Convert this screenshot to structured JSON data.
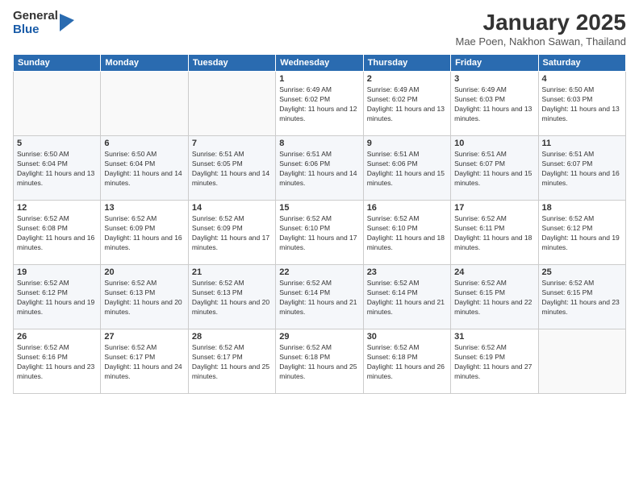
{
  "logo": {
    "general": "General",
    "blue": "Blue"
  },
  "header": {
    "month": "January 2025",
    "location": "Mae Poen, Nakhon Sawan, Thailand"
  },
  "weekdays": [
    "Sunday",
    "Monday",
    "Tuesday",
    "Wednesday",
    "Thursday",
    "Friday",
    "Saturday"
  ],
  "weeks": [
    [
      {
        "day": "",
        "sunrise": "",
        "sunset": "",
        "daylight": ""
      },
      {
        "day": "",
        "sunrise": "",
        "sunset": "",
        "daylight": ""
      },
      {
        "day": "",
        "sunrise": "",
        "sunset": "",
        "daylight": ""
      },
      {
        "day": "1",
        "sunrise": "Sunrise: 6:49 AM",
        "sunset": "Sunset: 6:02 PM",
        "daylight": "Daylight: 11 hours and 12 minutes."
      },
      {
        "day": "2",
        "sunrise": "Sunrise: 6:49 AM",
        "sunset": "Sunset: 6:02 PM",
        "daylight": "Daylight: 11 hours and 13 minutes."
      },
      {
        "day": "3",
        "sunrise": "Sunrise: 6:49 AM",
        "sunset": "Sunset: 6:03 PM",
        "daylight": "Daylight: 11 hours and 13 minutes."
      },
      {
        "day": "4",
        "sunrise": "Sunrise: 6:50 AM",
        "sunset": "Sunset: 6:03 PM",
        "daylight": "Daylight: 11 hours and 13 minutes."
      }
    ],
    [
      {
        "day": "5",
        "sunrise": "Sunrise: 6:50 AM",
        "sunset": "Sunset: 6:04 PM",
        "daylight": "Daylight: 11 hours and 13 minutes."
      },
      {
        "day": "6",
        "sunrise": "Sunrise: 6:50 AM",
        "sunset": "Sunset: 6:04 PM",
        "daylight": "Daylight: 11 hours and 14 minutes."
      },
      {
        "day": "7",
        "sunrise": "Sunrise: 6:51 AM",
        "sunset": "Sunset: 6:05 PM",
        "daylight": "Daylight: 11 hours and 14 minutes."
      },
      {
        "day": "8",
        "sunrise": "Sunrise: 6:51 AM",
        "sunset": "Sunset: 6:06 PM",
        "daylight": "Daylight: 11 hours and 14 minutes."
      },
      {
        "day": "9",
        "sunrise": "Sunrise: 6:51 AM",
        "sunset": "Sunset: 6:06 PM",
        "daylight": "Daylight: 11 hours and 15 minutes."
      },
      {
        "day": "10",
        "sunrise": "Sunrise: 6:51 AM",
        "sunset": "Sunset: 6:07 PM",
        "daylight": "Daylight: 11 hours and 15 minutes."
      },
      {
        "day": "11",
        "sunrise": "Sunrise: 6:51 AM",
        "sunset": "Sunset: 6:07 PM",
        "daylight": "Daylight: 11 hours and 16 minutes."
      }
    ],
    [
      {
        "day": "12",
        "sunrise": "Sunrise: 6:52 AM",
        "sunset": "Sunset: 6:08 PM",
        "daylight": "Daylight: 11 hours and 16 minutes."
      },
      {
        "day": "13",
        "sunrise": "Sunrise: 6:52 AM",
        "sunset": "Sunset: 6:09 PM",
        "daylight": "Daylight: 11 hours and 16 minutes."
      },
      {
        "day": "14",
        "sunrise": "Sunrise: 6:52 AM",
        "sunset": "Sunset: 6:09 PM",
        "daylight": "Daylight: 11 hours and 17 minutes."
      },
      {
        "day": "15",
        "sunrise": "Sunrise: 6:52 AM",
        "sunset": "Sunset: 6:10 PM",
        "daylight": "Daylight: 11 hours and 17 minutes."
      },
      {
        "day": "16",
        "sunrise": "Sunrise: 6:52 AM",
        "sunset": "Sunset: 6:10 PM",
        "daylight": "Daylight: 11 hours and 18 minutes."
      },
      {
        "day": "17",
        "sunrise": "Sunrise: 6:52 AM",
        "sunset": "Sunset: 6:11 PM",
        "daylight": "Daylight: 11 hours and 18 minutes."
      },
      {
        "day": "18",
        "sunrise": "Sunrise: 6:52 AM",
        "sunset": "Sunset: 6:12 PM",
        "daylight": "Daylight: 11 hours and 19 minutes."
      }
    ],
    [
      {
        "day": "19",
        "sunrise": "Sunrise: 6:52 AM",
        "sunset": "Sunset: 6:12 PM",
        "daylight": "Daylight: 11 hours and 19 minutes."
      },
      {
        "day": "20",
        "sunrise": "Sunrise: 6:52 AM",
        "sunset": "Sunset: 6:13 PM",
        "daylight": "Daylight: 11 hours and 20 minutes."
      },
      {
        "day": "21",
        "sunrise": "Sunrise: 6:52 AM",
        "sunset": "Sunset: 6:13 PM",
        "daylight": "Daylight: 11 hours and 20 minutes."
      },
      {
        "day": "22",
        "sunrise": "Sunrise: 6:52 AM",
        "sunset": "Sunset: 6:14 PM",
        "daylight": "Daylight: 11 hours and 21 minutes."
      },
      {
        "day": "23",
        "sunrise": "Sunrise: 6:52 AM",
        "sunset": "Sunset: 6:14 PM",
        "daylight": "Daylight: 11 hours and 21 minutes."
      },
      {
        "day": "24",
        "sunrise": "Sunrise: 6:52 AM",
        "sunset": "Sunset: 6:15 PM",
        "daylight": "Daylight: 11 hours and 22 minutes."
      },
      {
        "day": "25",
        "sunrise": "Sunrise: 6:52 AM",
        "sunset": "Sunset: 6:15 PM",
        "daylight": "Daylight: 11 hours and 23 minutes."
      }
    ],
    [
      {
        "day": "26",
        "sunrise": "Sunrise: 6:52 AM",
        "sunset": "Sunset: 6:16 PM",
        "daylight": "Daylight: 11 hours and 23 minutes."
      },
      {
        "day": "27",
        "sunrise": "Sunrise: 6:52 AM",
        "sunset": "Sunset: 6:17 PM",
        "daylight": "Daylight: 11 hours and 24 minutes."
      },
      {
        "day": "28",
        "sunrise": "Sunrise: 6:52 AM",
        "sunset": "Sunset: 6:17 PM",
        "daylight": "Daylight: 11 hours and 25 minutes."
      },
      {
        "day": "29",
        "sunrise": "Sunrise: 6:52 AM",
        "sunset": "Sunset: 6:18 PM",
        "daylight": "Daylight: 11 hours and 25 minutes."
      },
      {
        "day": "30",
        "sunrise": "Sunrise: 6:52 AM",
        "sunset": "Sunset: 6:18 PM",
        "daylight": "Daylight: 11 hours and 26 minutes."
      },
      {
        "day": "31",
        "sunrise": "Sunrise: 6:52 AM",
        "sunset": "Sunset: 6:19 PM",
        "daylight": "Daylight: 11 hours and 27 minutes."
      },
      {
        "day": "",
        "sunrise": "",
        "sunset": "",
        "daylight": ""
      }
    ]
  ]
}
